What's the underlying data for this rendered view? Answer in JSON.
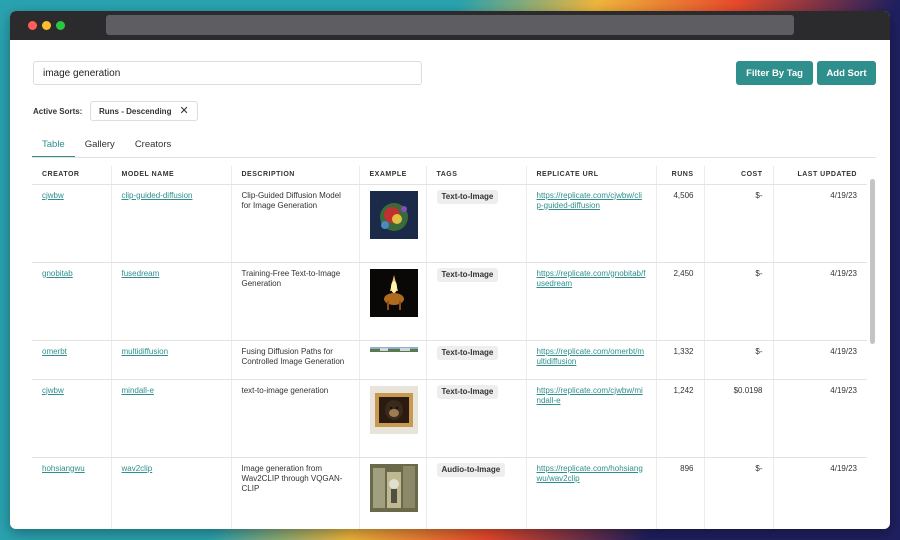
{
  "search": {
    "value": "image generation"
  },
  "buttons": {
    "filter_label": "Filter By Tag",
    "add_sort_label": "Add Sort"
  },
  "active_sorts": {
    "label": "Active Sorts:",
    "chip": "Runs - Descending",
    "chip_close": "✕"
  },
  "tabs": [
    "Table",
    "Gallery",
    "Creators"
  ],
  "table": {
    "columns": [
      "CREATOR",
      "MODEL NAME",
      "DESCRIPTION",
      "EXAMPLE",
      "TAGS",
      "REPLICATE URL",
      "RUNS",
      "COST",
      "LAST UPDATED"
    ],
    "rows": [
      {
        "creator": "cjwbw",
        "model": "clip-guided-diffusion",
        "description": "Clip-Guided Diffusion Model for Image Generation",
        "tag": "Text-to-Image",
        "url": "https://replicate.com/cjwbw/clip-guided-diffusion",
        "runs": "4,506",
        "cost": "$-",
        "updated": "4/19/23"
      },
      {
        "creator": "gnobitab",
        "model": "fusedream",
        "description": "Training-Free Text-to-Image Generation",
        "tag": "Text-to-Image",
        "url": "https://replicate.com/gnobitab/fusedream",
        "runs": "2,450",
        "cost": "$-",
        "updated": "4/19/23"
      },
      {
        "creator": "omerbt",
        "model": "multidiffusion",
        "description": "Fusing Diffusion Paths for Controlled Image Generation",
        "tag": "Text-to-Image",
        "url": "https://replicate.com/omerbt/multidiffusion",
        "runs": "1,332",
        "cost": "$-",
        "updated": "4/19/23"
      },
      {
        "creator": "cjwbw",
        "model": "mindall-e",
        "description": "text-to-image generation",
        "tag": "Text-to-Image",
        "url": "https://replicate.com/cjwbw/mindall-e",
        "runs": "1,242",
        "cost": "$0.0198",
        "updated": "4/19/23"
      },
      {
        "creator": "hohsiangwu",
        "model": "wav2clip",
        "description": "Image generation from Wav2CLIP through VQGAN-CLIP",
        "tag": "Audio-to-Image",
        "url": "https://replicate.com/hohsiangwu/wav2clip",
        "runs": "896",
        "cost": "$-",
        "updated": "4/19/23"
      }
    ]
  },
  "colors": {
    "accent": "#2f8f8d",
    "titlebar": "#2b2b2d"
  }
}
